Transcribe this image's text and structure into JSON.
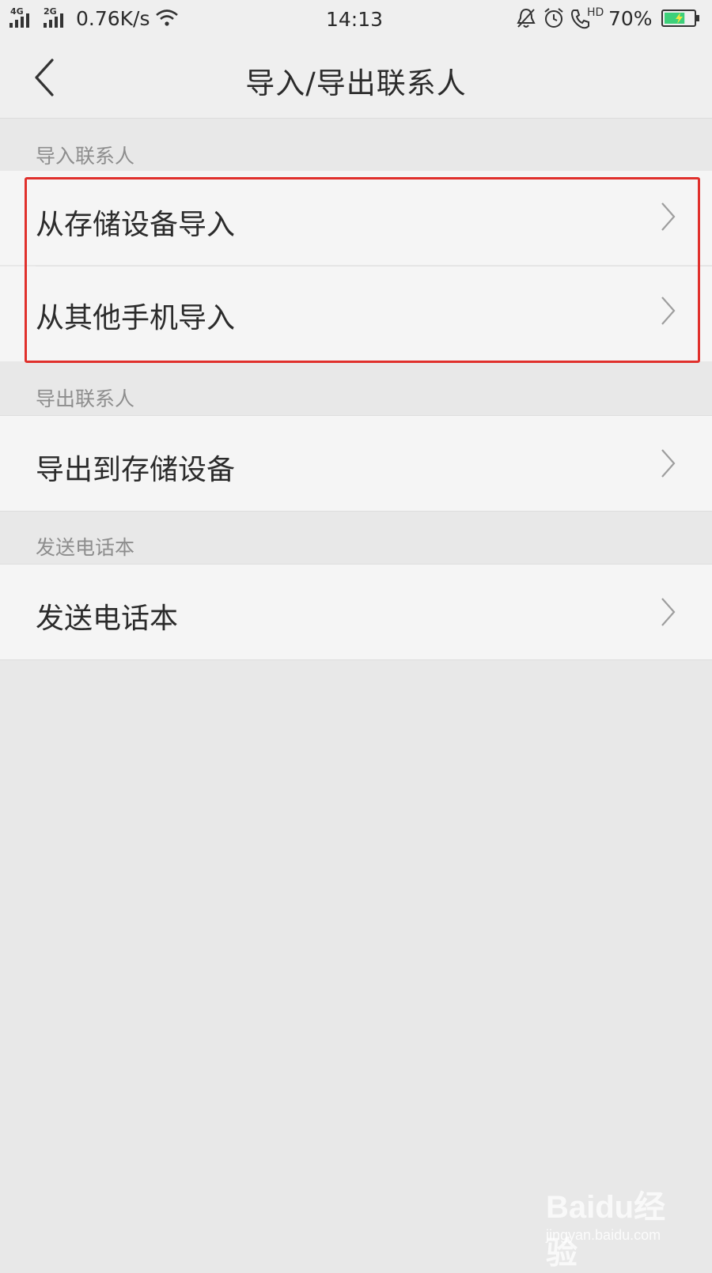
{
  "status_bar": {
    "net1": "4G",
    "net2": "2G",
    "speed": "0.76K/s",
    "time": "14:13",
    "hd": "HD",
    "battery": "70%",
    "battery_level": 0.7,
    "icons": [
      "signal-icon",
      "wifi-icon",
      "mute-bell-icon",
      "alarm-icon",
      "hd-call-icon",
      "battery-icon"
    ]
  },
  "header": {
    "title": "导入/导出联系人"
  },
  "sections": [
    {
      "header": "导入联系人",
      "items": [
        {
          "label": "从存储设备导入"
        },
        {
          "label": "从其他手机导入"
        }
      ]
    },
    {
      "header": "导出联系人",
      "items": [
        {
          "label": "导出到存储设备"
        }
      ]
    },
    {
      "header": "发送电话本",
      "items": [
        {
          "label": "发送电话本"
        }
      ]
    }
  ],
  "colors": {
    "highlight": "#e0302c",
    "battery": "#3dd07a"
  },
  "watermark": {
    "logo": "Baidu经验",
    "sub": "jingyan.baidu.com"
  }
}
